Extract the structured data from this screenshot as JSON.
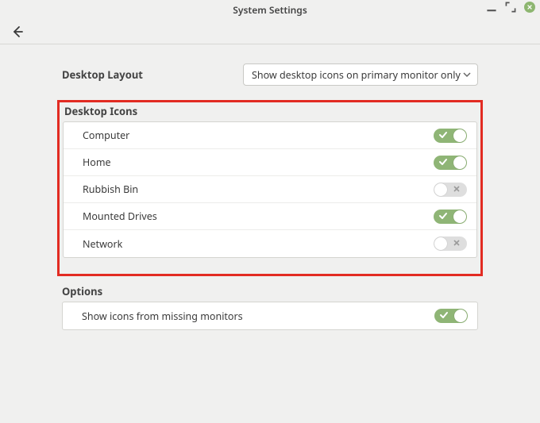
{
  "window": {
    "title": "System Settings"
  },
  "layout": {
    "label": "Desktop Layout",
    "dropdown_value": "Show desktop icons on primary monitor only"
  },
  "desktopIcons": {
    "title": "Desktop Icons",
    "items": [
      {
        "label": "Computer",
        "on": true
      },
      {
        "label": "Home",
        "on": true
      },
      {
        "label": "Rubbish Bin",
        "on": false
      },
      {
        "label": "Mounted Drives",
        "on": true
      },
      {
        "label": "Network",
        "on": false
      }
    ]
  },
  "options": {
    "title": "Options",
    "items": [
      {
        "label": "Show icons from missing monitors",
        "on": true
      }
    ]
  }
}
